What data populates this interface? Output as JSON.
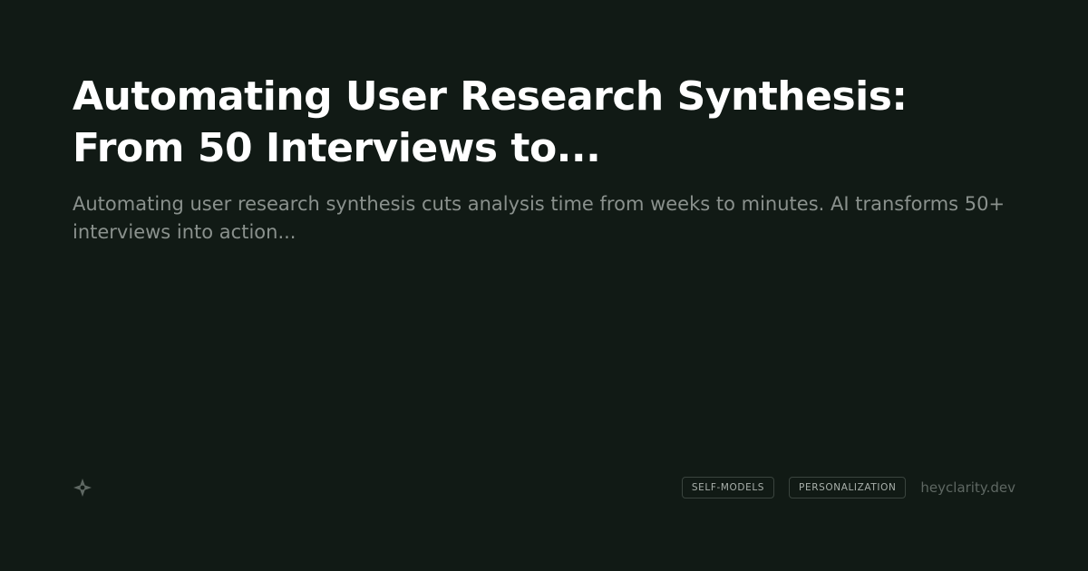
{
  "card": {
    "title": "Automating User Research Synthesis: From 50 Interviews to...",
    "description": "Automating user research synthesis cuts analysis time from weeks to minutes. AI transforms 50+ interviews into action...",
    "logo_icon": "sparkle-icon",
    "tags": [
      "SELF-MODELS",
      "PERSONALIZATION"
    ],
    "site": "heyclarity.dev"
  },
  "colors": {
    "background": "#111a15",
    "title": "#ffffff",
    "description": "#8a918d",
    "tag_text": "#a9b0ab",
    "tag_border": "#3a443e",
    "site": "#5e6762"
  }
}
